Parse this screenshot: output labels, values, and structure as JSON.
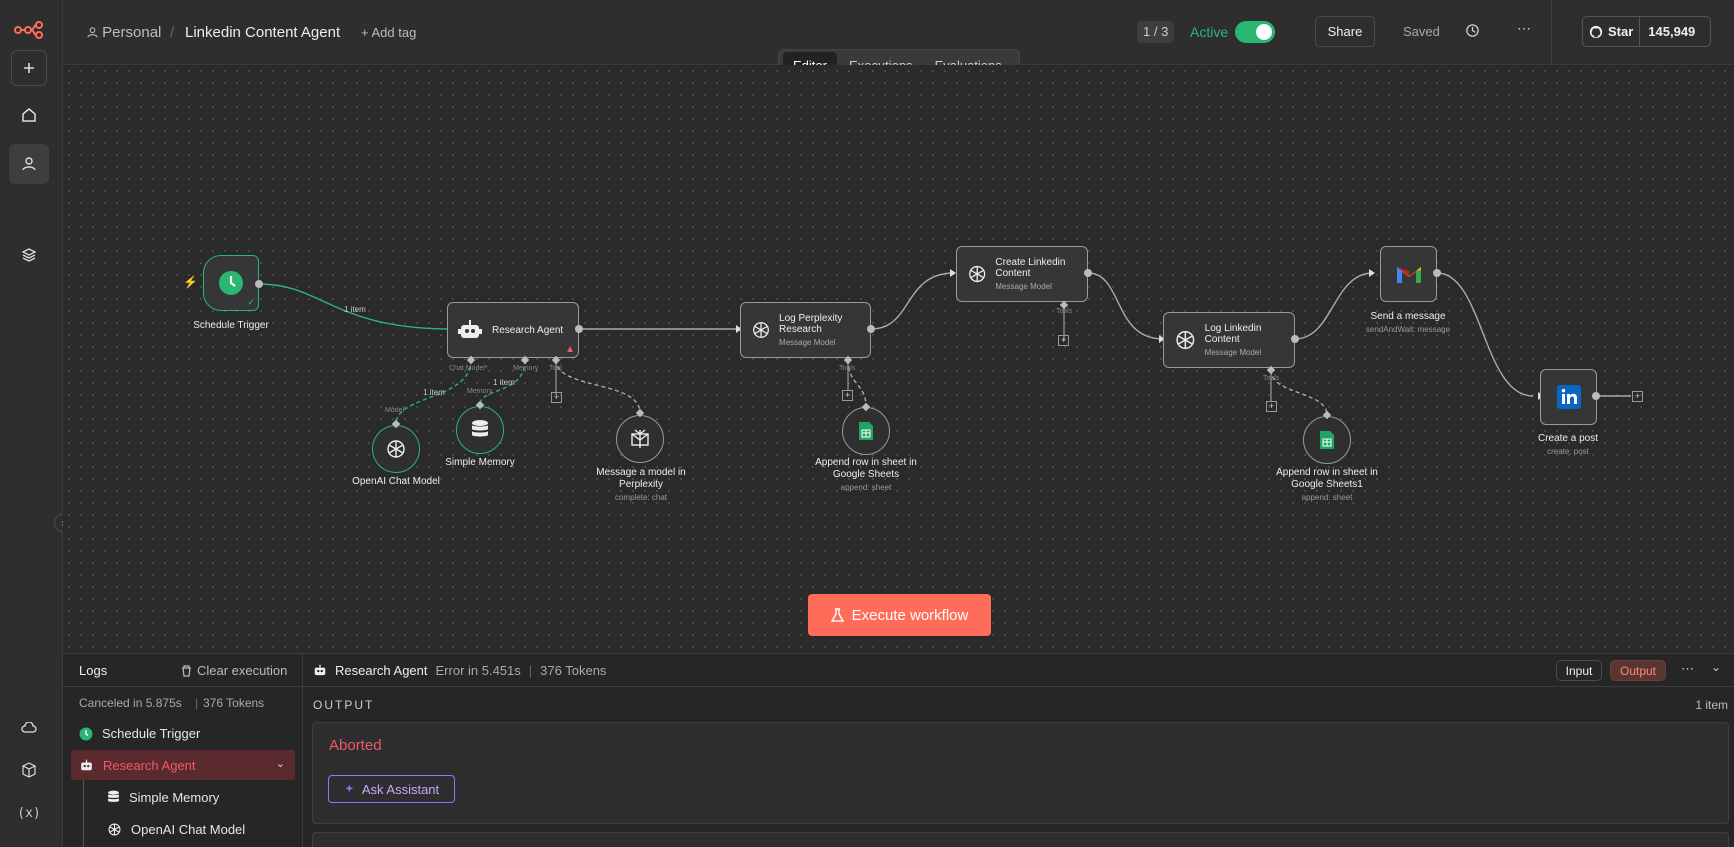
{
  "sidebar": {
    "icons": [
      "logo-icon",
      "plus-icon",
      "home-icon",
      "user-icon",
      "layers-icon",
      "cloud-icon",
      "box-icon",
      "variables-icon"
    ]
  },
  "header": {
    "project": "Personal",
    "workflow_name": "Linkedin Content Agent",
    "add_tag": "+ Add tag",
    "counter": "1 / 3",
    "active_label": "Active",
    "share": "Share",
    "saved": "Saved",
    "github_star": "Star",
    "star_count": "145,949"
  },
  "tabs": [
    "Editor",
    "Executions",
    "Evaluations"
  ],
  "canvas": {
    "execute_button": "Execute workflow",
    "nodes": {
      "schedule_trigger": {
        "title": "Schedule Trigger"
      },
      "research_agent": {
        "title": "Research Agent",
        "ports": [
          "Chat Model*",
          "Memory",
          "Tool"
        ]
      },
      "openai_chat": {
        "title": "OpenAI Chat Model",
        "port": "Model"
      },
      "simple_memory": {
        "title": "Simple Memory",
        "port": "Memory"
      },
      "perplexity_msg": {
        "title": "Message a model in Perplexity",
        "sub": "complete: chat"
      },
      "log_perplexity": {
        "title": "Log Perplexity Research",
        "sub": "Message Model",
        "port": "Tools"
      },
      "append_sheet": {
        "title": "Append row in sheet in Google Sheets",
        "sub": "append: sheet"
      },
      "create_linkedin": {
        "title": "Create Linkedin Content",
        "sub": "Message Model",
        "port": "Tools"
      },
      "log_linkedin": {
        "title": "Log Linkedin Content",
        "sub": "Message Model",
        "port": "Tools"
      },
      "append_sheet1": {
        "title": "Append row in sheet in Google Sheets1",
        "sub": "append: sheet"
      },
      "send_message": {
        "title": "Send a message",
        "sub": "sendAndWait: message"
      },
      "create_post": {
        "title": "Create a post",
        "sub": "create: post"
      }
    },
    "edge_labels": {
      "trigger_to_agent": "1 item",
      "model": "1 item",
      "memory": "1 item"
    }
  },
  "logs": {
    "title": "Logs",
    "clear": "Clear execution",
    "summary_time": "Canceled in 5.875s",
    "summary_tokens": "376 Tokens",
    "tree": [
      "Schedule Trigger",
      "Research Agent",
      "Simple Memory",
      "OpenAI Chat Model"
    ],
    "detail_title": "Research Agent",
    "detail_error": "Error in 5.451s",
    "detail_tokens": "376 Tokens",
    "input_tab": "Input",
    "output_tab": "Output",
    "output_heading": "OUTPUT",
    "item_count": "1 item",
    "aborted": "Aborted",
    "ask_assistant": "Ask Assistant"
  },
  "colors": {
    "accent": "#ff6d5a",
    "active_green": "#2bb673",
    "error_red": "#f0596b",
    "purple": "#a66cff"
  }
}
